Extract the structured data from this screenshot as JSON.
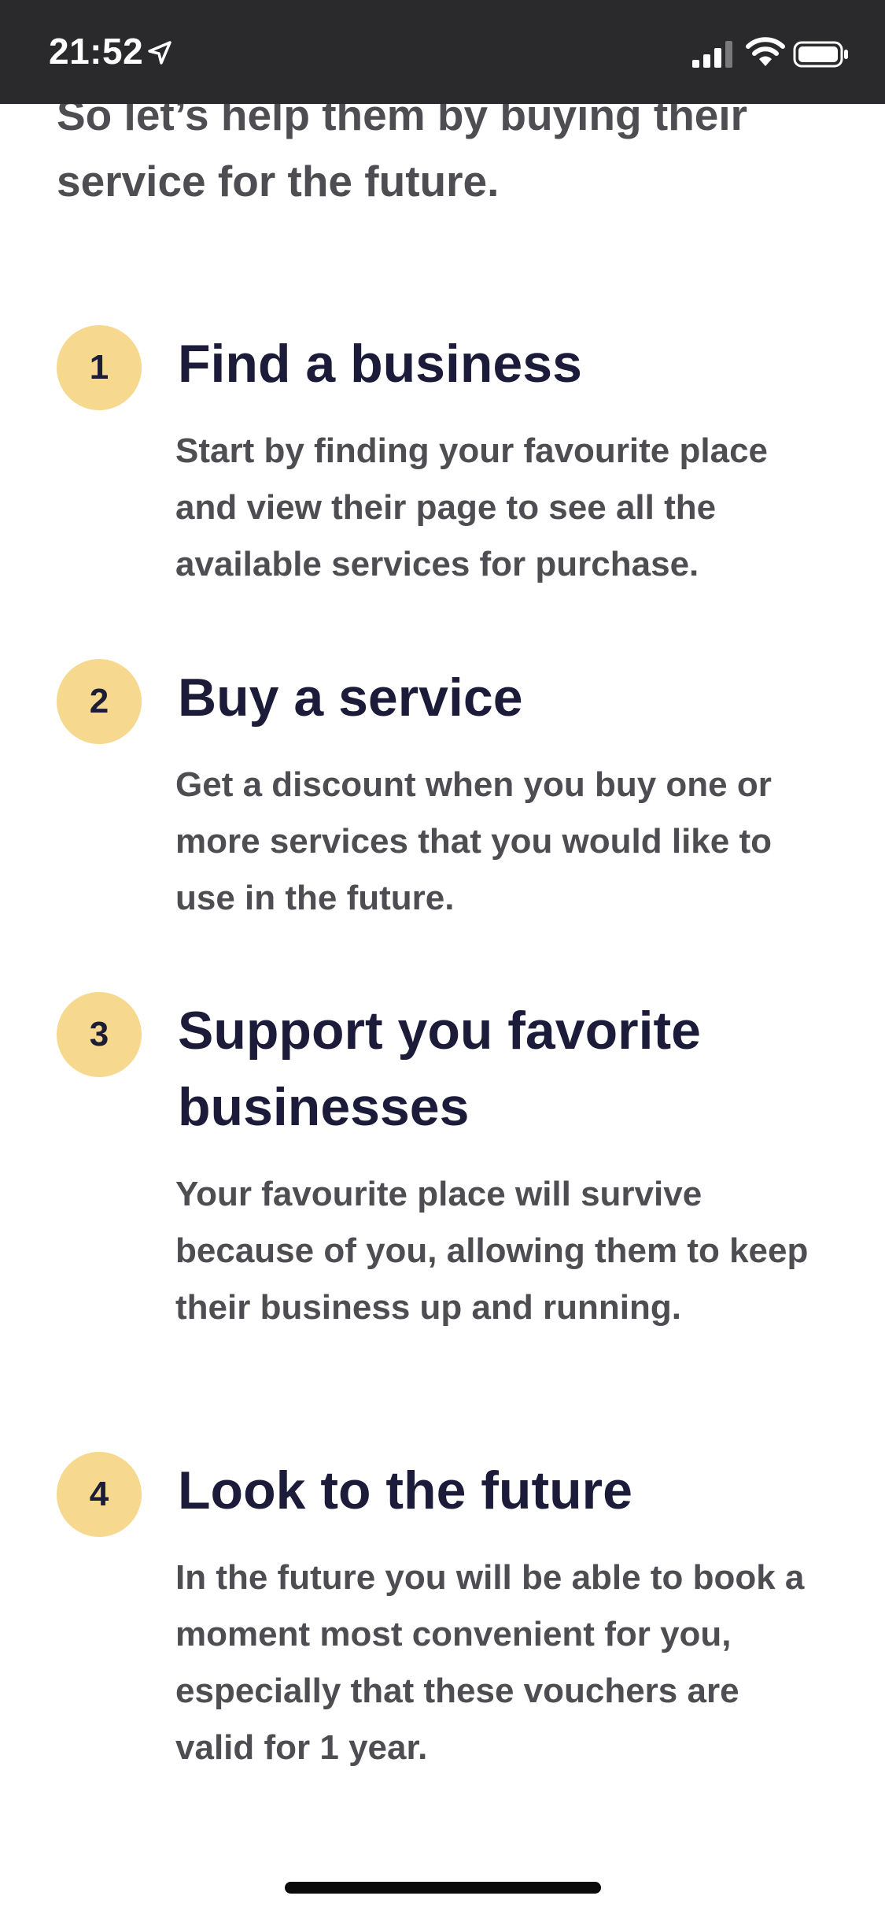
{
  "status_bar": {
    "time": "21:52",
    "icons": [
      "location-arrow-icon",
      "signal-icon",
      "wifi-icon",
      "battery-icon"
    ]
  },
  "intro": {
    "text": "So let’s help them by buying their service for the future."
  },
  "steps": [
    {
      "number": "1",
      "title": "Find a business",
      "description": "Start by finding your favourite place and view their page to see all the available services for purchase."
    },
    {
      "number": "2",
      "title": "Buy a service",
      "description": "Get a discount when you buy one or more services that you would like to use in the future."
    },
    {
      "number": "3",
      "title": "Support you favorite businesses",
      "description": "Your favourite place will survive because of you, allowing them to keep their business up and running."
    },
    {
      "number": "4",
      "title": "Look to the future",
      "description": "In the future you will be able to book a moment most convenient for you, especially that these vouchers are valid for 1 year."
    }
  ],
  "colors": {
    "status_bar_bg": "#2a2a2c",
    "circle_fill": "#f6d88e",
    "title_text": "#1c1c3a",
    "body_text": "#4d4d52"
  }
}
